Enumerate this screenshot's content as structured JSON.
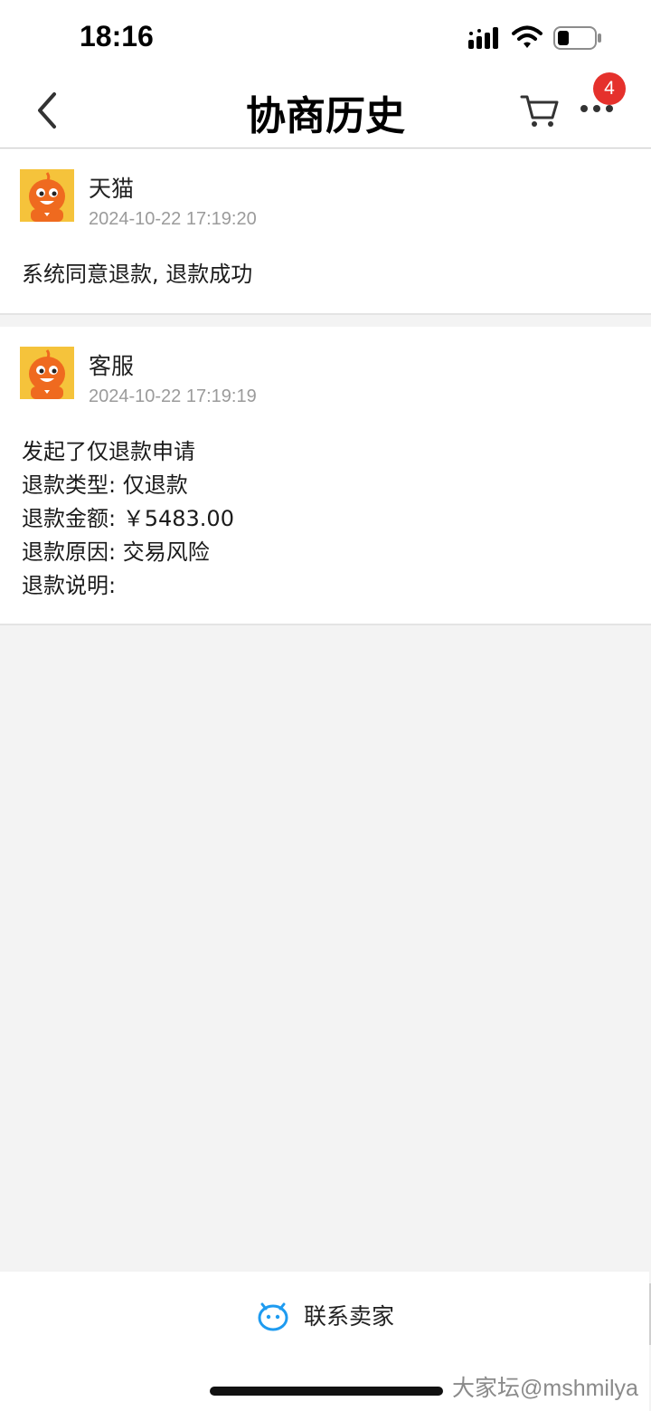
{
  "status_bar": {
    "time": "18:16"
  },
  "nav": {
    "title": "协商历史",
    "badge_count": "4"
  },
  "history": [
    {
      "author": "天猫",
      "timestamp": "2024-10-22 17:19:20",
      "message": "系统同意退款, 退款成功"
    },
    {
      "author": "客服",
      "timestamp": "2024-10-22 17:19:19",
      "lines": [
        "发起了仅退款申请",
        "退款类型: 仅退款",
        "退款金额: ￥5483.00",
        "退款原因: 交易风险",
        "退款说明:"
      ]
    }
  ],
  "bottom": {
    "contact_label": "联系卖家"
  },
  "watermark": "大家坛@mshmilya",
  "colors": {
    "badge": "#e5312c",
    "accent_blue": "#1e9bf0",
    "avatar_bg": "#f5c33b",
    "avatar_orange": "#ef6a1f"
  }
}
